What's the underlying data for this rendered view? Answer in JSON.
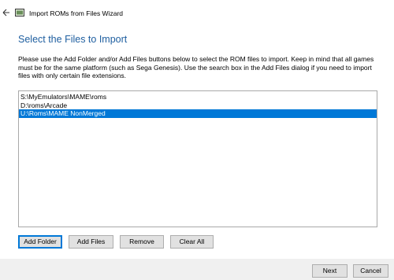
{
  "window": {
    "title": "Import ROMs from Files Wizard"
  },
  "page": {
    "heading": "Select the Files to Import",
    "description": "Please use the Add Folder and/or Add Files buttons below to select the ROM files to import. Keep in mind that all games must be for the same platform (such as Sega Genesis). Use the search box in the Add Files dialog if you need to import files with only certain file extensions."
  },
  "file_list": {
    "items": [
      {
        "path": "S:\\MyEmulators\\MAME\\roms",
        "selected": false
      },
      {
        "path": "D:\\roms\\Arcade",
        "selected": false
      },
      {
        "path": "U:\\Roms\\MAME NonMerged",
        "selected": true
      }
    ],
    "selection_color": "#0078d7"
  },
  "actions": {
    "add_folder": "Add Folder",
    "add_files": "Add Files",
    "remove": "Remove",
    "clear_all": "Clear All"
  },
  "footer": {
    "next": "Next",
    "cancel": "Cancel"
  },
  "colors": {
    "heading": "#1f5fa0",
    "accent": "#0078d7",
    "footer_bg": "#f0f0f0"
  },
  "icons": {
    "back": "back-arrow-icon",
    "app": "app-window-icon"
  }
}
